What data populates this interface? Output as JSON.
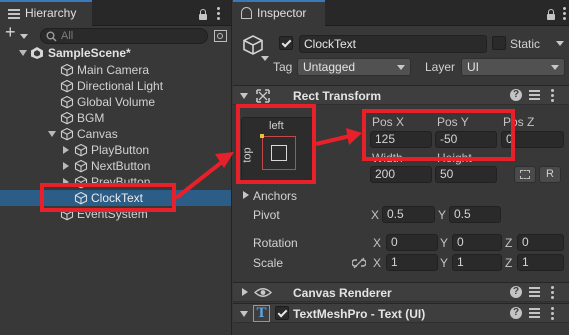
{
  "hierarchy": {
    "tab_title": "Hierarchy",
    "search_placeholder": "All",
    "add_label": "+",
    "items": [
      {
        "label": "SampleScene*"
      },
      {
        "label": "Main Camera"
      },
      {
        "label": "Directional Light"
      },
      {
        "label": "Global Volume"
      },
      {
        "label": "BGM"
      },
      {
        "label": "Canvas"
      },
      {
        "label": "PlayButton"
      },
      {
        "label": "NextButton"
      },
      {
        "label": "PrevButton"
      },
      {
        "label": "ClockText"
      },
      {
        "label": "EventSystem"
      }
    ]
  },
  "inspector": {
    "tab_title": "Inspector",
    "object_name": "ClockText",
    "static_label": "Static",
    "tag_label": "Tag",
    "tag_value": "Untagged",
    "layer_label": "Layer",
    "layer_value": "UI",
    "rect_transform": {
      "title": "Rect Transform",
      "anchor_h": "left",
      "anchor_v": "top",
      "pos_x_label": "Pos X",
      "pos_y_label": "Pos Y",
      "pos_z_label": "Pos Z",
      "pos_x": "125",
      "pos_y": "-50",
      "pos_z": "0",
      "width_label": "Width",
      "height_label": "Height",
      "width": "200",
      "height": "50",
      "r_button": "R",
      "anchors_label": "Anchors",
      "pivot_label": "Pivot",
      "pivot_x": "0.5",
      "pivot_y": "0.5",
      "rotation_label": "Rotation",
      "rot_x": "0",
      "rot_y": "0",
      "rot_z": "0",
      "scale_label": "Scale",
      "scale_x": "1",
      "scale_y": "1",
      "scale_z": "1",
      "x_letter": "X",
      "y_letter": "Y",
      "z_letter": "Z"
    },
    "canvas_renderer": {
      "title": "Canvas Renderer"
    },
    "textmeshpro": {
      "title": "TextMeshPro - Text (UI)"
    },
    "help_glyph": "?"
  },
  "colors": {
    "annotation_red": "#e8202a",
    "selection_blue": "#2c5d87",
    "tab_accent": "#3a79bb"
  }
}
